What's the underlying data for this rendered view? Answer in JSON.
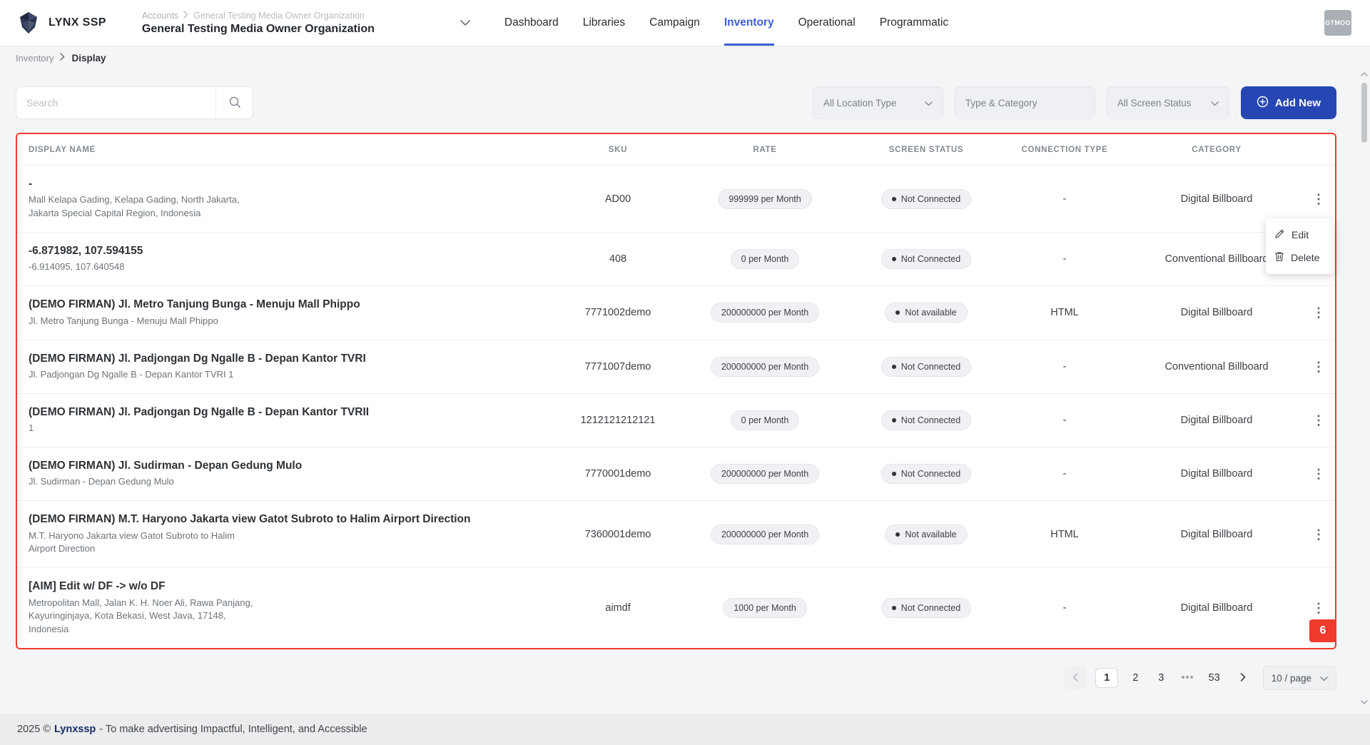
{
  "colors": {
    "nav_active_blue": "#3d5ed2",
    "button_blue": "#2646b4",
    "annotation_red": "#ee3b2c",
    "brand_navy": "#1c2d6b"
  },
  "header": {
    "logo_text": "LYNX SSP",
    "account_breadcrumb": {
      "root": "Accounts",
      "org": "General Testing Media Owner Organization"
    },
    "org_name": "General Testing Media Owner Organization",
    "nav": [
      {
        "label": "Dashboard",
        "active": false
      },
      {
        "label": "Libraries",
        "active": false
      },
      {
        "label": "Campaign",
        "active": false
      },
      {
        "label": "Inventory",
        "active": true
      },
      {
        "label": "Operational",
        "active": false
      },
      {
        "label": "Programmatic",
        "active": false
      }
    ],
    "avatar_label": "GTMOO"
  },
  "breadcrumb": {
    "parent": "Inventory",
    "current": "Display"
  },
  "toolbar": {
    "search_placeholder": "Search",
    "filters": [
      {
        "label": "All Location Type",
        "chevron": true,
        "w": "w1"
      },
      {
        "label": "Type & Category",
        "chevron": false,
        "w": "w2"
      },
      {
        "label": "All Screen Status",
        "chevron": true,
        "w": "w3"
      }
    ],
    "add_new_label": "Add New"
  },
  "table": {
    "columns": [
      "DISPLAY NAME",
      "SKU",
      "RATE",
      "SCREEN STATUS",
      "CONNECTION TYPE",
      "CATEGORY"
    ],
    "rows": [
      {
        "name": "-",
        "subtitle": "Mall Kelapa Gading, Kelapa Gading, North Jakarta, Jakarta Special Capital Region, Indonesia",
        "sku": "AD00",
        "rate": "999999 per Month",
        "screen_status": "Not Connected",
        "connection_type": "-",
        "category": "Digital Billboard"
      },
      {
        "name": "-6.871982, 107.594155",
        "subtitle": "-6.914095, 107.640548",
        "sku": "408",
        "rate": "0 per Month",
        "screen_status": "Not Connected",
        "connection_type": "-",
        "category": "Conventional Billboard"
      },
      {
        "name": "(DEMO FIRMAN) Jl. Metro Tanjung Bunga - Menuju Mall Phippo",
        "subtitle": "Jl. Metro Tanjung Bunga - Menuju Mall Phippo",
        "sku": "7771002demo",
        "rate": "200000000 per Month",
        "screen_status": "Not available",
        "connection_type": "HTML",
        "category": "Digital Billboard"
      },
      {
        "name": "(DEMO FIRMAN) Jl. Padjongan Dg Ngalle B - Depan Kantor TVRI",
        "subtitle": "Jl. Padjongan Dg Ngalle B - Depan Kantor TVRI 1",
        "sku": "7771007demo",
        "rate": "200000000 per Month",
        "screen_status": "Not Connected",
        "connection_type": "-",
        "category": "Conventional Billboard"
      },
      {
        "name": "(DEMO FIRMAN) Jl. Padjongan Dg Ngalle B - Depan Kantor TVRII",
        "subtitle": "1",
        "sku": "1212121212121",
        "rate": "0 per Month",
        "screen_status": "Not Connected",
        "connection_type": "-",
        "category": "Digital Billboard"
      },
      {
        "name": "(DEMO FIRMAN) Jl. Sudirman - Depan Gedung Mulo",
        "subtitle": "Jl. Sudirman - Depan Gedung Mulo",
        "sku": "7770001demo",
        "rate": "200000000 per Month",
        "screen_status": "Not Connected",
        "connection_type": "-",
        "category": "Digital Billboard"
      },
      {
        "name": "(DEMO FIRMAN) M.T. Haryono Jakarta view Gatot Subroto to Halim Airport Direction",
        "subtitle": "M.T. Haryono Jakarta view Gatot Subroto to Halim Airport Direction",
        "sku": "7360001demo",
        "rate": "200000000 per Month",
        "screen_status": "Not available",
        "connection_type": "HTML",
        "category": "Digital Billboard"
      },
      {
        "name": "[AIM] Edit w/ DF -> w/o DF",
        "subtitle": "Metropolitan Mall, Jalan K. H. Noer Ali, Rawa Panjang, Kayuringinjaya, Kota Bekasi, West Java, 17148, Indonesia",
        "sku": "aimdf",
        "rate": "1000 per Month",
        "screen_status": "Not Connected",
        "connection_type": "-",
        "category": "Digital Billboard"
      }
    ]
  },
  "context_menu": {
    "items": [
      {
        "label": "Edit"
      },
      {
        "label": "Delete"
      }
    ]
  },
  "annotation_badge": "6",
  "pagination": {
    "items": [
      {
        "label": "1",
        "type": "page",
        "active": true
      },
      {
        "label": "2",
        "type": "page",
        "active": false
      },
      {
        "label": "3",
        "type": "page",
        "active": false
      },
      {
        "label": "•••",
        "type": "ellipsis",
        "active": false
      },
      {
        "label": "53",
        "type": "page",
        "active": false
      }
    ],
    "page_size": "10 / page"
  },
  "footer": {
    "year": "2025 ©",
    "brand": "Lynxssp",
    "tagline": "- To make advertising Impactful, Intelligent, and Accessible"
  },
  "icons": {
    "kebab": "⋮"
  }
}
